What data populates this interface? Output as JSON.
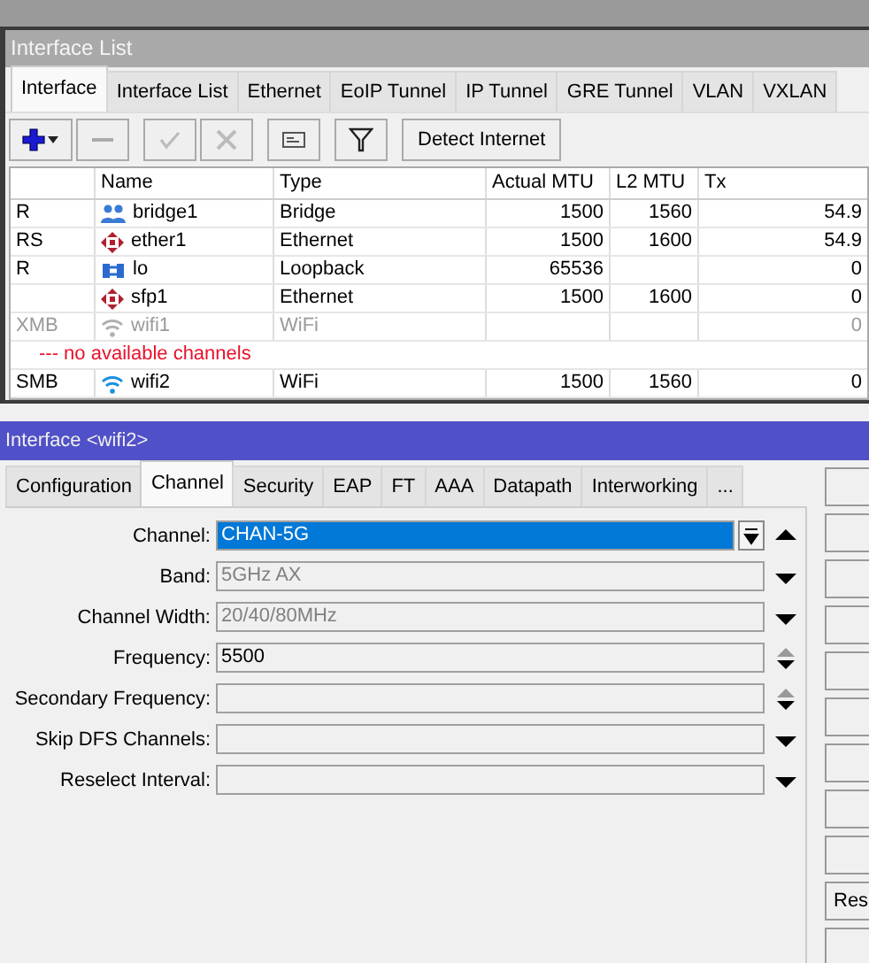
{
  "list_window": {
    "title": "Interface List",
    "tabs": [
      {
        "label": "Interface",
        "selected": true
      },
      {
        "label": "Interface List",
        "selected": false
      },
      {
        "label": "Ethernet",
        "selected": false
      },
      {
        "label": "EoIP Tunnel",
        "selected": false
      },
      {
        "label": "IP Tunnel",
        "selected": false
      },
      {
        "label": "GRE Tunnel",
        "selected": false
      },
      {
        "label": "VLAN",
        "selected": false
      },
      {
        "label": "VXLAN",
        "selected": false
      }
    ],
    "toolbar": {
      "detect_button": "Detect Internet"
    },
    "table": {
      "columns": [
        "Name",
        "Type",
        "Actual MTU",
        "L2 MTU",
        "Tx"
      ],
      "rows": [
        {
          "kind": "bridge",
          "flags": "R",
          "name": "bridge1",
          "type": "Bridge",
          "actual_mtu": "1500",
          "l2_mtu": "1560",
          "tx": "54.9",
          "disabled": false
        },
        {
          "kind": "ethernet",
          "flags": "RS",
          "name": "ether1",
          "type": "Ethernet",
          "actual_mtu": "1500",
          "l2_mtu": "1600",
          "tx": "54.9",
          "disabled": false
        },
        {
          "kind": "loopback",
          "flags": "R",
          "name": "lo",
          "type": "Loopback",
          "actual_mtu": "65536",
          "tx": "0",
          "disabled": false
        },
        {
          "kind": "ethernet",
          "name": "sfp1",
          "type": "Ethernet",
          "actual_mtu": "1500",
          "l2_mtu": "1600",
          "tx": "0",
          "disabled": false
        },
        {
          "kind": "wifi",
          "flags": "XMB",
          "name": "wifi1",
          "type": "WiFi",
          "tx": "0",
          "disabled": true
        },
        {
          "kind": "comment",
          "comment": "--- no available channels"
        },
        {
          "kind": "wifi",
          "flags": "SMB",
          "name": "wifi2",
          "type": "WiFi",
          "actual_mtu": "1500",
          "l2_mtu": "1560",
          "tx": "0",
          "disabled": false
        }
      ]
    }
  },
  "detail_window": {
    "title": "Interface <wifi2>",
    "tabs": [
      {
        "label": "Configuration",
        "selected": false
      },
      {
        "label": "Channel",
        "selected": true
      },
      {
        "label": "Security",
        "selected": false
      },
      {
        "label": "EAP",
        "selected": false
      },
      {
        "label": "FT",
        "selected": false
      },
      {
        "label": "AAA",
        "selected": false
      },
      {
        "label": "Datapath",
        "selected": false
      },
      {
        "label": "Interworking",
        "selected": false
      },
      {
        "label": "...",
        "selected": false
      }
    ],
    "fields": [
      {
        "label": "Channel:",
        "value": "CHAN-5G",
        "selected": true,
        "dimmed": false,
        "kind": "up"
      },
      {
        "label": "Band:",
        "value": "5GHz AX",
        "selected": false,
        "dimmed": true,
        "kind": "down"
      },
      {
        "label": "Channel Width:",
        "value": "20/40/80MHz",
        "selected": false,
        "dimmed": true,
        "kind": "down"
      },
      {
        "label": "Frequency:",
        "value": "5500",
        "selected": false,
        "dimmed": false,
        "kind": "updown"
      },
      {
        "label": "Secondary Frequency:",
        "selected": false,
        "kind": "updown"
      },
      {
        "label": "Skip DFS Channels:",
        "selected": false,
        "kind": "down"
      },
      {
        "label": "Reselect Interval:",
        "selected": false,
        "kind": "down"
      }
    ],
    "side_button": "Res"
  }
}
